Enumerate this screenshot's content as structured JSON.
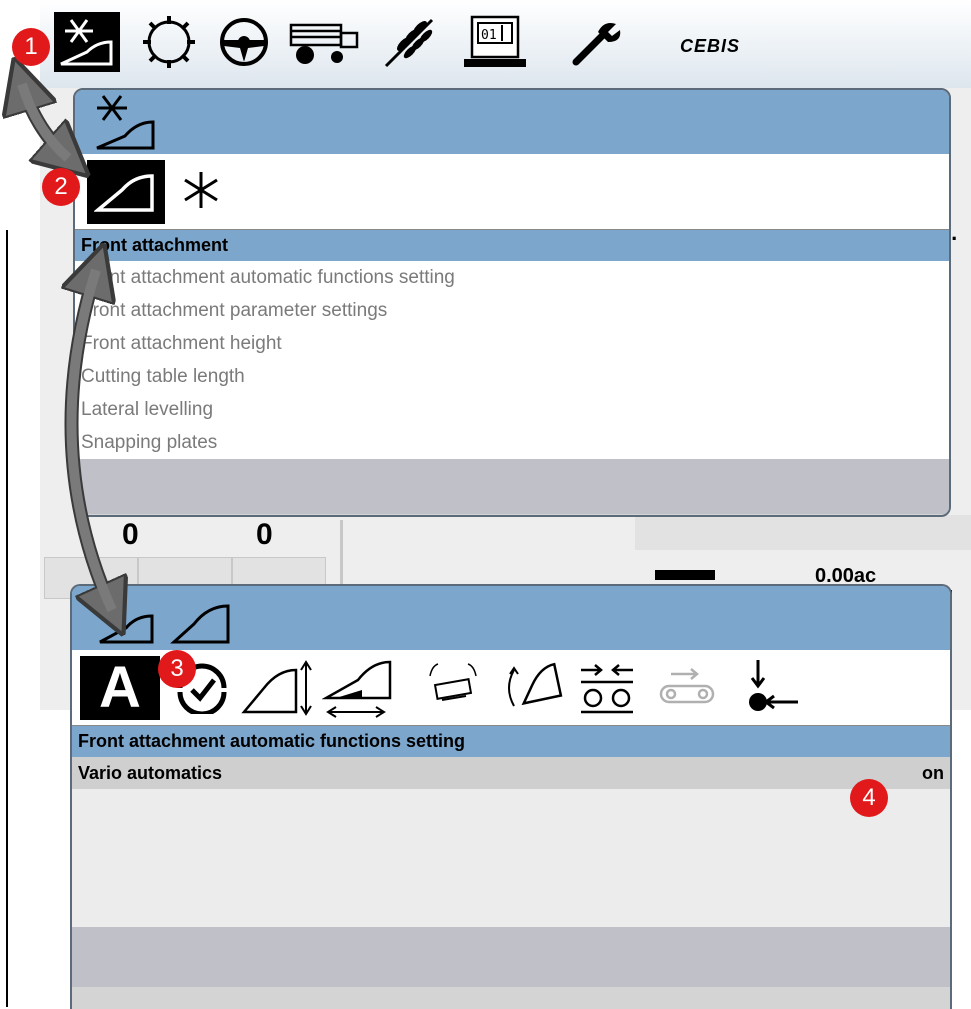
{
  "topbar": {
    "icons": [
      "front-attachment-icon",
      "threshing-icon",
      "steering-icon",
      "combine-icon",
      "grain-icon",
      "terminal-icon",
      "wrench-icon"
    ],
    "brand": "CEBIS"
  },
  "background": {
    "values": [
      "0",
      "0"
    ],
    "area": "0.00ac"
  },
  "popup1": {
    "header_icon": "front-attachment-icon",
    "tabs": [
      "front-attachment-tab-icon",
      "asterisk-icon"
    ],
    "section_title": "Front attachment",
    "items": [
      "Front attachment automatic functions setting",
      "Front attachment parameter settings",
      "Front attachment height",
      "Cutting table length",
      "Lateral levelling",
      "Snapping plates"
    ]
  },
  "popup2": {
    "tabs": [
      "auto-icon",
      "gauge-icon",
      "height-icon",
      "cutting-length-icon",
      "lateral-icon",
      "tilt-icon",
      "spacing-icon",
      "conveyor-icon",
      "stop-icon"
    ],
    "auto_letter": "A",
    "section_title": "Front attachment automatic functions setting",
    "rows": [
      {
        "label": "Vario automatics",
        "value": "on"
      }
    ]
  },
  "badges": [
    "1",
    "2",
    "3",
    "4"
  ],
  "colors": {
    "header_blue": "#7da6cc",
    "badge_red": "#e1191b"
  }
}
